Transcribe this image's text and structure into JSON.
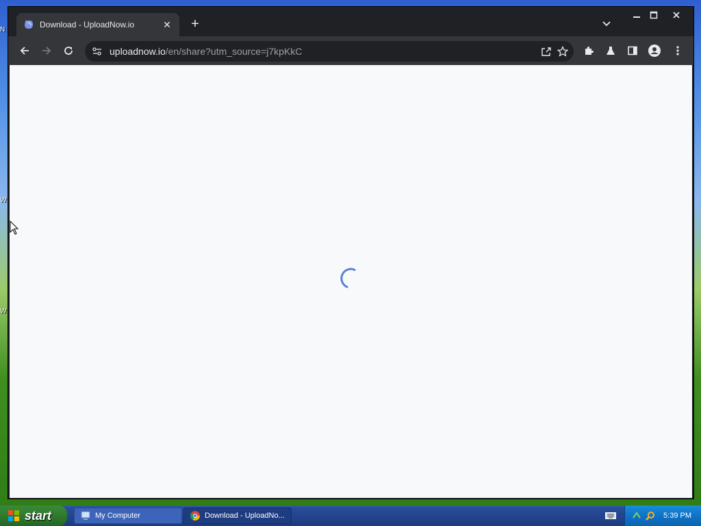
{
  "browser": {
    "tab": {
      "title": "Download - UploadNow.io",
      "favicon": "uploadnow-favicon-icon"
    },
    "omnibox": {
      "url_host": "uploadnow.io",
      "url_path": "/en/share?utm_source=j7kpKkC"
    },
    "content": {
      "state": "loading",
      "spinner_color": "#5b7fd6",
      "background": "#f8f9fa"
    }
  },
  "taskbar": {
    "start_label": "start",
    "tasks": [
      {
        "label": "My Computer",
        "icon": "my-computer-icon"
      },
      {
        "label": "Download - UploadNo...",
        "icon": "chrome-icon"
      }
    ],
    "clock": "5:39 PM"
  },
  "colors": {
    "tabstrip": "#202124",
    "toolbar": "#35363a",
    "taskbar": "#234590",
    "start": "#2e7a2e",
    "tray": "#0e73c6"
  }
}
